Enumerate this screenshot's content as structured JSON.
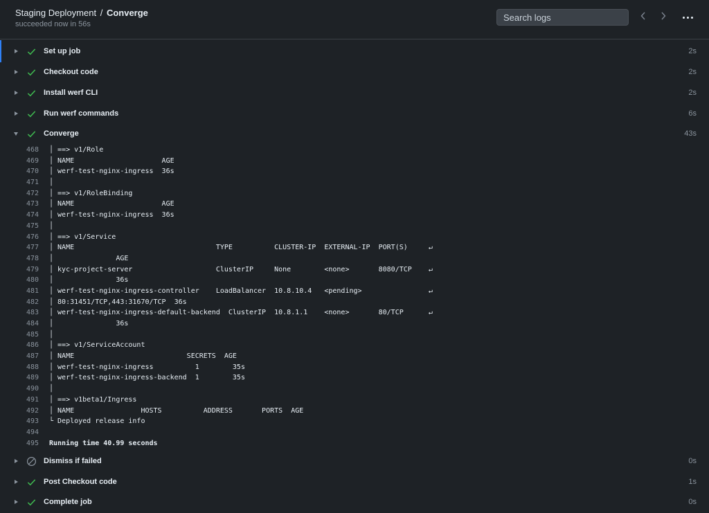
{
  "header": {
    "workflow": "Staging Deployment",
    "separator": "/",
    "job": "Converge",
    "status": "succeeded now in 56s",
    "search_placeholder": "Search logs"
  },
  "icons": {
    "prev": "chevron-left-icon",
    "next": "chevron-right-icon",
    "more": "kebab-menu-icon",
    "success": "check-icon",
    "skipped": "skipped-icon"
  },
  "colors": {
    "success": "#3fb950",
    "accent": "#2f81f7",
    "background": "#1e2226"
  },
  "steps_before": [
    {
      "name": "Set up job",
      "duration": "2s",
      "status": "success"
    },
    {
      "name": "Checkout code",
      "duration": "2s",
      "status": "success"
    },
    {
      "name": "Install werf CLI",
      "duration": "2s",
      "status": "success"
    },
    {
      "name": "Run werf commands",
      "duration": "6s",
      "status": "success"
    },
    {
      "name": "Converge",
      "duration": "43s",
      "status": "success",
      "expanded": true
    }
  ],
  "log_lines": [
    {
      "n": "468",
      "t": "│ ==> v1/Role"
    },
    {
      "n": "469",
      "t": "│ NAME                     AGE"
    },
    {
      "n": "470",
      "t": "│ werf-test-nginx-ingress  36s"
    },
    {
      "n": "471",
      "t": "│"
    },
    {
      "n": "472",
      "t": "│ ==> v1/RoleBinding"
    },
    {
      "n": "473",
      "t": "│ NAME                     AGE"
    },
    {
      "n": "474",
      "t": "│ werf-test-nginx-ingress  36s"
    },
    {
      "n": "475",
      "t": "│"
    },
    {
      "n": "476",
      "t": "│ ==> v1/Service"
    },
    {
      "n": "477",
      "t": "│ NAME                                  TYPE          CLUSTER-IP  EXTERNAL-IP  PORT(S)     ↵"
    },
    {
      "n": "478",
      "t": "│               AGE"
    },
    {
      "n": "479",
      "t": "│ kyc-project-server                    ClusterIP     None        <none>       8080/TCP    ↵"
    },
    {
      "n": "480",
      "t": "│               36s"
    },
    {
      "n": "481",
      "t": "│ werf-test-nginx-ingress-controller    LoadBalancer  10.8.10.4   <pending>                ↵"
    },
    {
      "n": "482",
      "t": "│ 80:31451/TCP,443:31670/TCP  36s"
    },
    {
      "n": "483",
      "t": "│ werf-test-nginx-ingress-default-backend  ClusterIP  10.8.1.1    <none>       80/TCP      ↵"
    },
    {
      "n": "484",
      "t": "│               36s"
    },
    {
      "n": "485",
      "t": "│"
    },
    {
      "n": "486",
      "t": "│ ==> v1/ServiceAccount"
    },
    {
      "n": "487",
      "t": "│ NAME                           SECRETS  AGE"
    },
    {
      "n": "488",
      "t": "│ werf-test-nginx-ingress          1        35s"
    },
    {
      "n": "489",
      "t": "│ werf-test-nginx-ingress-backend  1        35s"
    },
    {
      "n": "490",
      "t": "│"
    },
    {
      "n": "491",
      "t": "│ ==> v1beta1/Ingress"
    },
    {
      "n": "492",
      "t": "│ NAME                HOSTS          ADDRESS       PORTS  AGE"
    },
    {
      "n": "493",
      "t": "└ Deployed release info"
    },
    {
      "n": "494",
      "t": ""
    },
    {
      "n": "495",
      "t": "Running time 40.99 seconds",
      "bold": true
    }
  ],
  "steps_after": [
    {
      "name": "Dismiss if failed",
      "duration": "0s",
      "status": "skipped"
    },
    {
      "name": "Post Checkout code",
      "duration": "1s",
      "status": "success"
    },
    {
      "name": "Complete job",
      "duration": "0s",
      "status": "success"
    }
  ]
}
